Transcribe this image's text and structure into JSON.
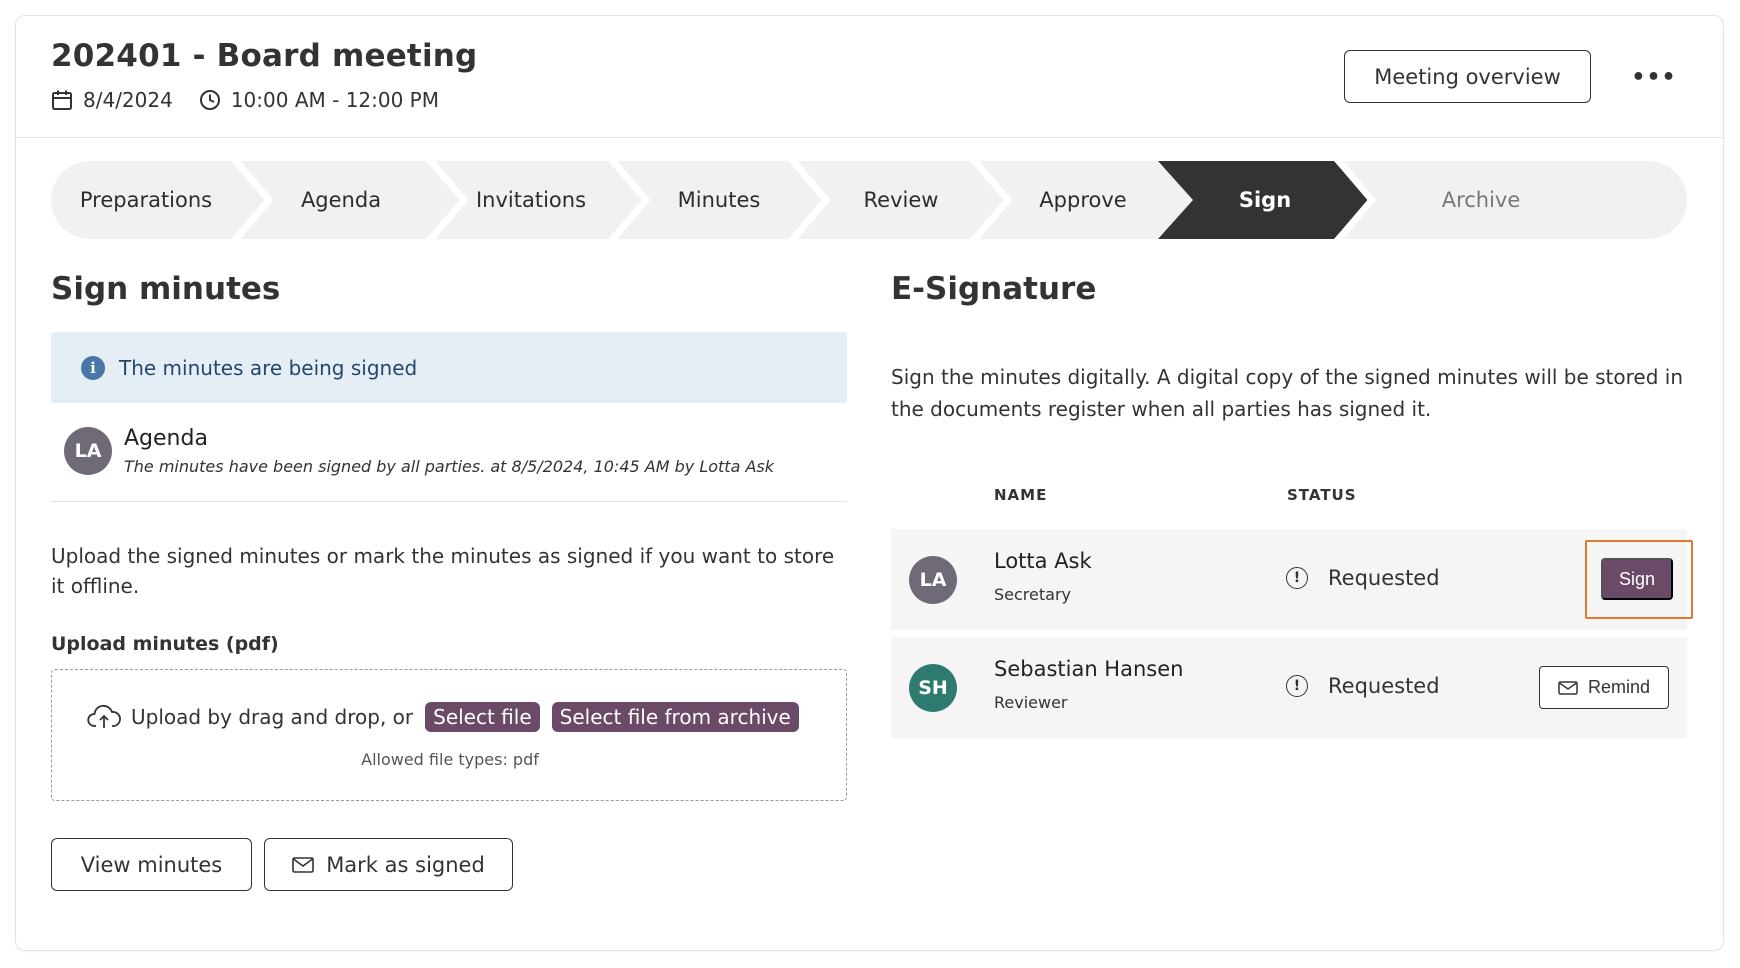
{
  "header": {
    "title": "202401 - Board meeting",
    "date": "8/4/2024",
    "time": "10:00 AM - 12:00 PM",
    "overview_button": "Meeting overview",
    "more_label": "•••"
  },
  "stepper": {
    "steps": [
      {
        "label": "Preparations",
        "state": "done"
      },
      {
        "label": "Agenda",
        "state": "done"
      },
      {
        "label": "Invitations",
        "state": "done"
      },
      {
        "label": "Minutes",
        "state": "done"
      },
      {
        "label": "Review",
        "state": "done"
      },
      {
        "label": "Approve",
        "state": "done"
      },
      {
        "label": "Sign",
        "state": "active"
      },
      {
        "label": "Archive",
        "state": "future"
      }
    ]
  },
  "sign_minutes": {
    "title": "Sign minutes",
    "info_icon": "i",
    "info_text": "The minutes are being signed",
    "agenda_avatar": "LA",
    "agenda_title": "Agenda",
    "agenda_subtitle": "The minutes have been signed by all parties. at 8/5/2024, 10:45 AM by Lotta Ask",
    "upload_text": "Upload the signed minutes or mark the minutes as signed if you want to store it offline.",
    "upload_label": "Upload minutes (pdf)",
    "drop_text": "Upload by drag and drop, or",
    "select_file": "Select file",
    "select_archive": "Select file from archive",
    "allowed_types": "Allowed file types: pdf",
    "view_button": "View minutes",
    "mark_button": "Mark as signed"
  },
  "esignature": {
    "title": "E-Signature",
    "description": "Sign the minutes digitally. A digital copy of the signed minutes will be stored in the documents register when all parties has signed it.",
    "col_name": "NAME",
    "col_status": "STATUS",
    "signers": [
      {
        "initials": "LA",
        "name": "Lotta Ask",
        "role": "Secretary",
        "status": "Requested",
        "action": "Sign",
        "avatar_color": "#6f6a75"
      },
      {
        "initials": "SH",
        "name": "Sebastian Hansen",
        "role": "Reviewer",
        "status": "Requested",
        "action": "Remind",
        "avatar_color": "#2f7a6e"
      }
    ],
    "status_icon": "!"
  },
  "colors": {
    "accent": "#6b4a68",
    "active_step": "#333333",
    "info_bg": "#e6eef5",
    "highlight": "#e07a2e"
  }
}
